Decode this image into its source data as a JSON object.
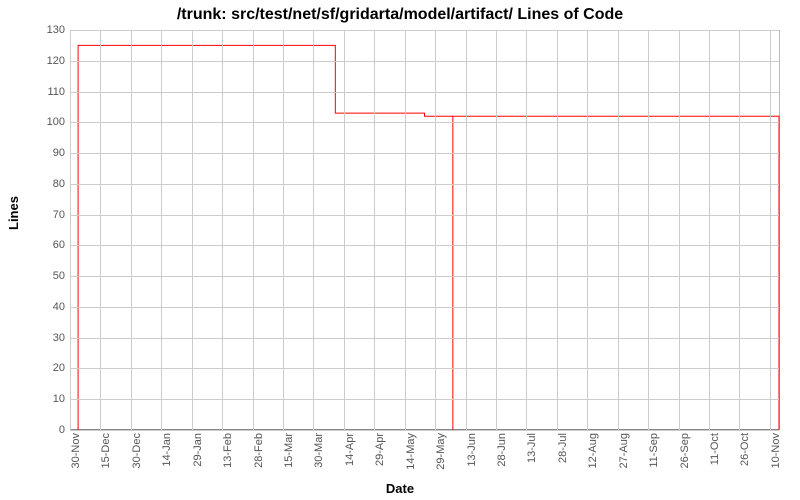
{
  "chart_data": {
    "type": "line",
    "title": "/trunk: src/test/net/sf/gridarta/model/artifact/ Lines of Code",
    "xlabel": "Date",
    "ylabel": "Lines",
    "ylim": [
      0,
      130
    ],
    "yticks": [
      0,
      10,
      20,
      30,
      40,
      50,
      60,
      70,
      80,
      90,
      100,
      110,
      120,
      130
    ],
    "x_categories": [
      "30-Nov",
      "15-Dec",
      "30-Dec",
      "14-Jan",
      "29-Jan",
      "13-Feb",
      "28-Feb",
      "15-Mar",
      "30-Mar",
      "14-Apr",
      "29-Apr",
      "14-May",
      "29-May",
      "13-Jun",
      "28-Jun",
      "13-Jul",
      "28-Jul",
      "12-Aug",
      "27-Aug",
      "11-Sep",
      "26-Sep",
      "11-Oct",
      "26-Oct",
      "10-Nov"
    ],
    "series": [
      {
        "name": "Lines of Code",
        "color": "#ff0000",
        "points": [
          {
            "x": "04-Dec",
            "y": 0
          },
          {
            "x": "04-Dec",
            "y": 125
          },
          {
            "x": "10-Apr",
            "y": 125
          },
          {
            "x": "10-Apr",
            "y": 103
          },
          {
            "x": "24-May",
            "y": 103
          },
          {
            "x": "24-May",
            "y": 102
          },
          {
            "x": "07-Jun",
            "y": 102
          },
          {
            "x": "07-Jun",
            "y": 0
          },
          {
            "x": "07-Jun",
            "y": 102
          },
          {
            "x": "15-Nov",
            "y": 102
          },
          {
            "x": "15-Nov",
            "y": 0
          }
        ]
      }
    ],
    "x_numeric_start": 0,
    "x_numeric_end": 350,
    "x_tick_positions": [
      0,
      15,
      30,
      45,
      60,
      75,
      90,
      105,
      120,
      135,
      150,
      165,
      180,
      195,
      210,
      225,
      240,
      255,
      270,
      285,
      300,
      315,
      330,
      345
    ],
    "x_point_positions": [
      4,
      4,
      131,
      131,
      175,
      175,
      189,
      189,
      189,
      350,
      350
    ]
  }
}
